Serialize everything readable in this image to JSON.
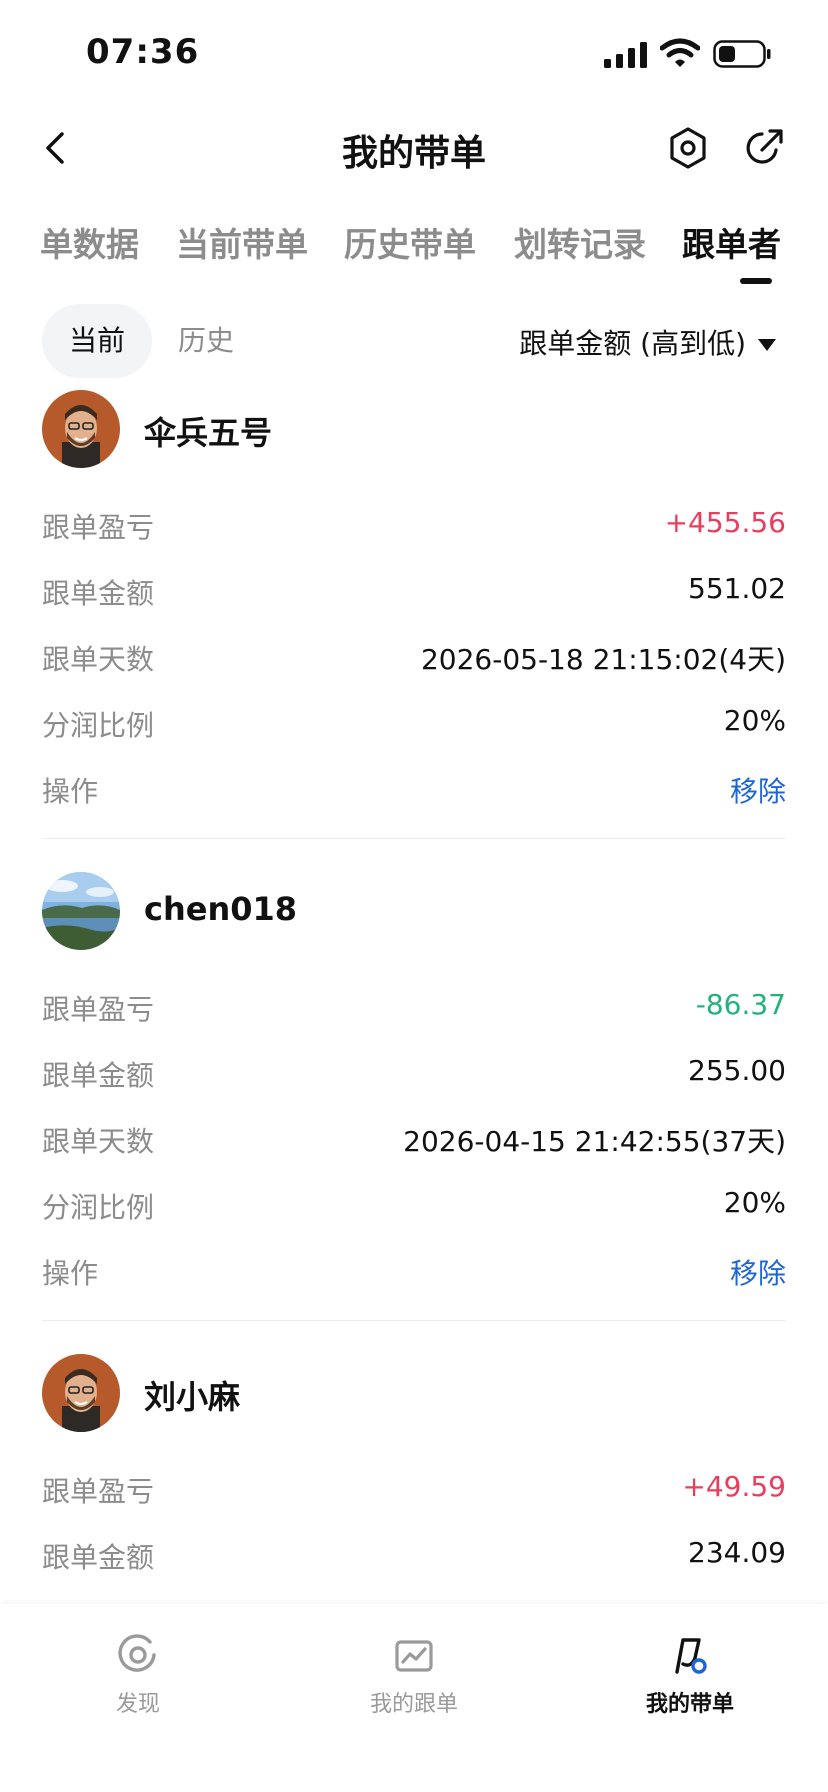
{
  "status_bar": {
    "time": "07:36"
  },
  "header": {
    "title": "我的带单"
  },
  "tabs": [
    {
      "label": "单数据"
    },
    {
      "label": "当前带单"
    },
    {
      "label": "历史带单"
    },
    {
      "label": "划转记录"
    },
    {
      "label": "跟单者"
    }
  ],
  "subtabs": {
    "current": "当前",
    "history": "历史",
    "sort": "跟单金额 (高到低)"
  },
  "labels": {
    "pnl": "跟单盈亏",
    "amount": "跟单金额",
    "days": "跟单天数",
    "share": "分润比例",
    "action": "操作"
  },
  "followers": [
    {
      "name": "伞兵五号",
      "pnl": "+455.56",
      "amount": "551.02",
      "days": "2026-05-18 21:15:02(4天)",
      "share": "20%",
      "action": "移除"
    },
    {
      "name": "chen018",
      "pnl": "-86.37",
      "amount": "255.00",
      "days": "2026-04-15 21:42:55(37天)",
      "share": "20%",
      "action": "移除"
    },
    {
      "name": "刘小麻",
      "pnl": "+49.59",
      "amount": "234.09"
    }
  ],
  "bottom_nav": [
    {
      "label": "发现",
      "icon": "discover-icon"
    },
    {
      "label": "我的跟单",
      "icon": "chart-icon"
    },
    {
      "label": "我的带单",
      "icon": "flag-icon"
    }
  ],
  "colors": {
    "profit": "#ea3d5e",
    "loss": "#22b37b",
    "link": "#1f64d8"
  }
}
